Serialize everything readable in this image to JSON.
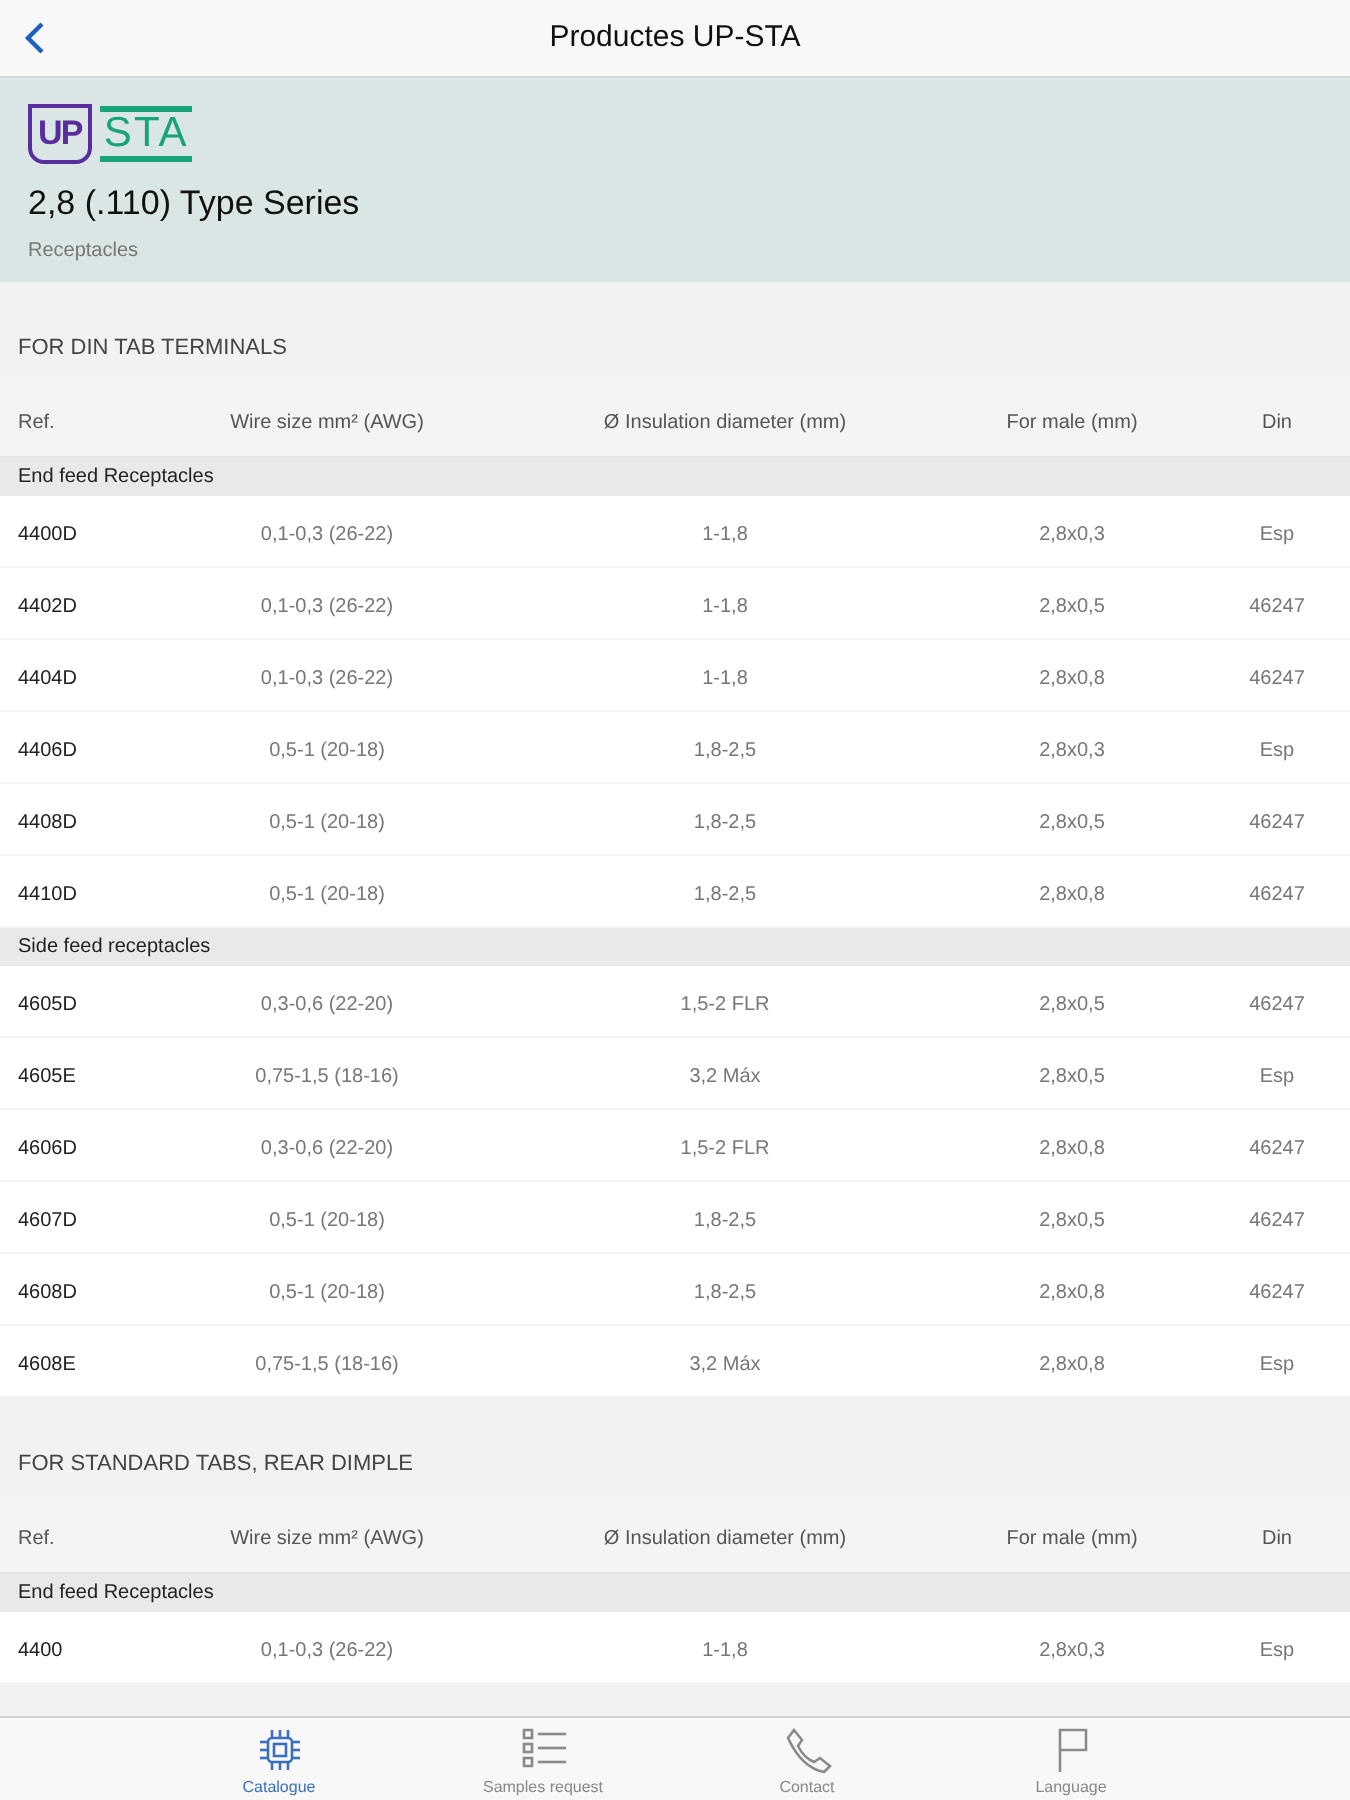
{
  "nav_bar": {
    "title": "Productes UP-STA"
  },
  "header": {
    "logo": {
      "left": "UP",
      "right": "STA"
    },
    "title": "2,8 (.110) Type Series",
    "subtitle": "Receptacles"
  },
  "sections": [
    {
      "title": "FOR DIN TAB TERMINALS",
      "columns": [
        "Ref.",
        "Wire size mm² (AWG)",
        "Ø Insulation diameter (mm)",
        "For male (mm)",
        "Din"
      ],
      "groups": [
        {
          "title": "End feed Receptacles",
          "rows": [
            [
              "4400D",
              "0,1-0,3 (26-22)",
              "1-1,8",
              "2,8x0,3",
              "Esp"
            ],
            [
              "4402D",
              "0,1-0,3 (26-22)",
              "1-1,8",
              "2,8x0,5",
              "46247"
            ],
            [
              "4404D",
              "0,1-0,3 (26-22)",
              "1-1,8",
              "2,8x0,8",
              "46247"
            ],
            [
              "4406D",
              "0,5-1 (20-18)",
              "1,8-2,5",
              "2,8x0,3",
              "Esp"
            ],
            [
              "4408D",
              "0,5-1 (20-18)",
              "1,8-2,5",
              "2,8x0,5",
              "46247"
            ],
            [
              "4410D",
              "0,5-1 (20-18)",
              "1,8-2,5",
              "2,8x0,8",
              "46247"
            ]
          ]
        },
        {
          "title": "Side feed receptacles",
          "rows": [
            [
              "4605D",
              "0,3-0,6 (22-20)",
              "1,5-2 FLR",
              "2,8x0,5",
              "46247"
            ],
            [
              "4605E",
              "0,75-1,5 (18-16)",
              "3,2 Máx",
              "2,8x0,5",
              "Esp"
            ],
            [
              "4606D",
              "0,3-0,6 (22-20)",
              "1,5-2 FLR",
              "2,8x0,8",
              "46247"
            ],
            [
              "4607D",
              "0,5-1 (20-18)",
              "1,8-2,5",
              "2,8x0,5",
              "46247"
            ],
            [
              "4608D",
              "0,5-1 (20-18)",
              "1,8-2,5",
              "2,8x0,8",
              "46247"
            ],
            [
              "4608E",
              "0,75-1,5 (18-16)",
              "3,2 Máx",
              "2,8x0,8",
              "Esp"
            ]
          ]
        }
      ]
    },
    {
      "title": "FOR STANDARD TABS, REAR DIMPLE",
      "columns": [
        "Ref.",
        "Wire size mm² (AWG)",
        "Ø Insulation diameter (mm)",
        "For male (mm)",
        "Din"
      ],
      "groups": [
        {
          "title": "End feed Receptacles",
          "rows": [
            [
              "4400",
              "0,1-0,3 (26-22)",
              "1-1,8",
              "2,8x0,3",
              "Esp"
            ]
          ]
        }
      ]
    }
  ],
  "tab_bar": [
    {
      "kind": "chip",
      "label": "Catalogue",
      "selected": true
    },
    {
      "kind": "list",
      "label": "Samples request",
      "selected": false
    },
    {
      "kind": "phone",
      "label": "Contact",
      "selected": false
    },
    {
      "kind": "flag",
      "label": "Language",
      "selected": false
    }
  ]
}
